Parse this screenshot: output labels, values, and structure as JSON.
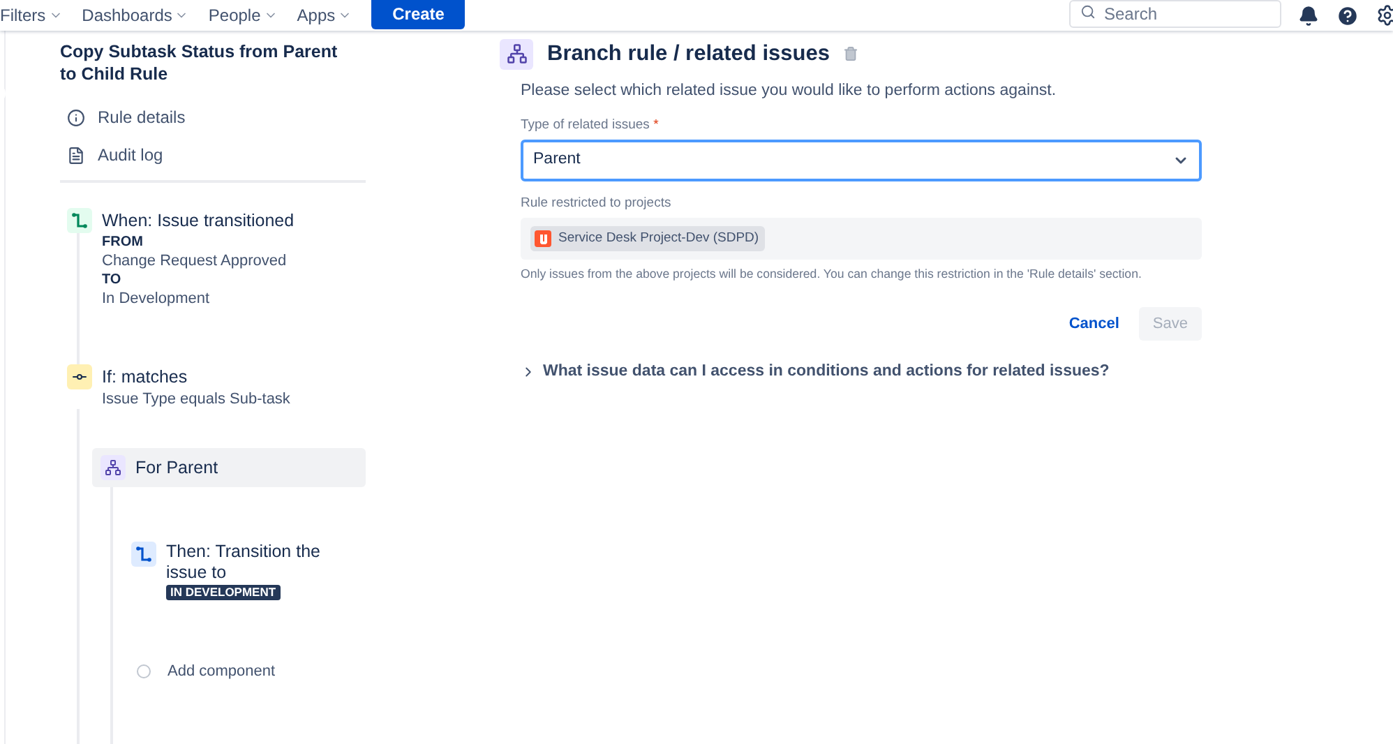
{
  "nav": {
    "menus": [
      {
        "label": "Filters"
      },
      {
        "label": "Dashboards"
      },
      {
        "label": "People"
      },
      {
        "label": "Apps"
      }
    ],
    "create": "Create",
    "search": {
      "placeholder": "Search"
    }
  },
  "rule": {
    "title": "Copy Subtask Status from Parent to Child Rule",
    "links": [
      {
        "kind": "info",
        "label": "Rule details"
      },
      {
        "kind": "log",
        "label": "Audit log"
      }
    ]
  },
  "trigger": {
    "title": "When: Issue transitioned",
    "lines": [
      {
        "kind": "label",
        "text": "FROM"
      },
      {
        "kind": "value",
        "text": "Change Request Approved"
      },
      {
        "kind": "label",
        "text": "TO"
      },
      {
        "kind": "value",
        "text": "In Development"
      }
    ]
  },
  "condition": {
    "title": "If: matches",
    "detail": "Issue Type equals Sub-task"
  },
  "branch": {
    "title": "For Parent",
    "selected": true,
    "action": {
      "title": "Then: Transition the issue to",
      "status": "IN DEVELOPMENT"
    },
    "add": "Add component"
  },
  "panel": {
    "title": "Branch rule / related issues",
    "intro": "Please select which related issue you would like to perform actions against.",
    "field_label": "Type of related issues",
    "required_mark": "*",
    "field_value": "Parent",
    "projects_label": "Rule restricted to projects",
    "project": "Service Desk Project-Dev (SDPD)",
    "help": "Only issues from the above projects will be considered. You can change this restriction in the 'Rule details' section.",
    "cancel": "Cancel",
    "save": {
      "label": "Save",
      "disabled": true
    },
    "faq": {
      "label": "What issue data can I access in conditions and actions for related issues?",
      "expanded": false
    }
  }
}
